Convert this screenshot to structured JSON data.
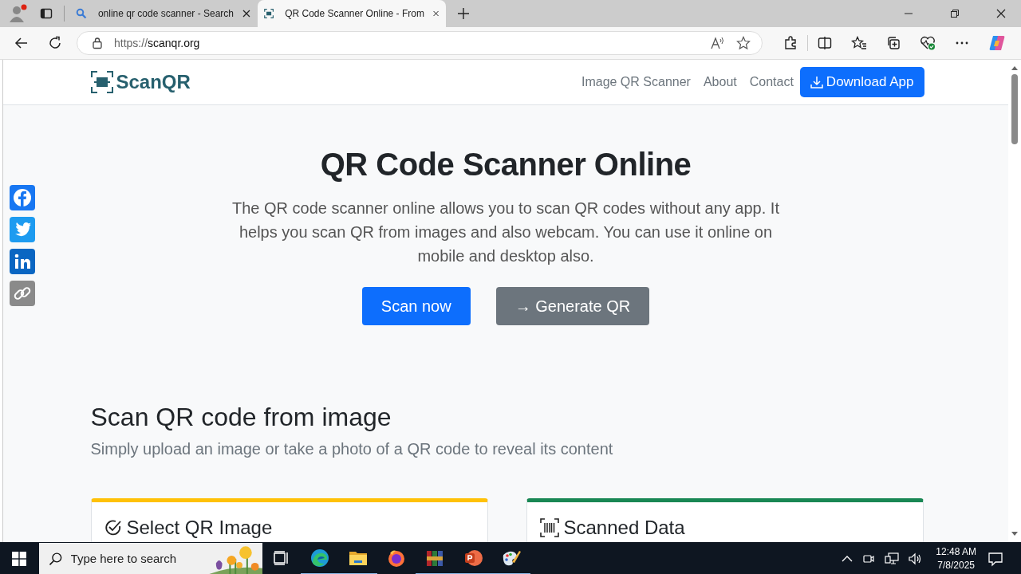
{
  "browser": {
    "tabs": [
      {
        "title": "online qr code scanner - Search",
        "kind": "search",
        "selected": false
      },
      {
        "title": "QR Code Scanner Online - From",
        "kind": "qr",
        "selected": true
      }
    ],
    "url_scheme": "https://",
    "url_host": "scanqr.org"
  },
  "site": {
    "logo": "ScanQR",
    "nav": [
      {
        "label": "Image QR Scanner",
        "kind": "link"
      },
      {
        "label": "About",
        "kind": "link"
      },
      {
        "label": "Contact",
        "kind": "link"
      },
      {
        "label": "Download App",
        "kind": "button"
      }
    ],
    "share": [
      {
        "kind": "facebook"
      },
      {
        "kind": "twitter"
      },
      {
        "kind": "linkedin"
      },
      {
        "kind": "link"
      }
    ],
    "hero": {
      "title": "QR Code Scanner Online",
      "text": "The QR code scanner online allows you to scan QR codes without any app. It helps you scan QR from images and also webcam. You can use it online on mobile and desktop also.",
      "buttons": [
        {
          "label": "Scan now",
          "kind": "primary"
        },
        {
          "label": "→ Generate QR",
          "kind": "secondary"
        }
      ]
    },
    "section": {
      "title": "Scan QR code from image",
      "subtitle": "Simply upload an image or take a photo of a QR code to reveal its content"
    },
    "cards": [
      {
        "title": "Select QR Image",
        "kind": "check",
        "color": "#ffc107"
      },
      {
        "title": "Scanned Data",
        "kind": "barcode",
        "color": "#198754"
      }
    ]
  },
  "taskbar": {
    "search": {
      "placeholder": "Type here to search"
    },
    "apps": [
      {
        "kind": "taskview",
        "running": false
      },
      {
        "kind": "edge",
        "running": true
      },
      {
        "kind": "explorer",
        "running": true
      },
      {
        "kind": "firefox",
        "running": false
      },
      {
        "kind": "winrar",
        "running": true
      },
      {
        "kind": "powerpoint",
        "running": true
      },
      {
        "kind": "paint",
        "running": true
      }
    ],
    "time": "12:48 AM",
    "date": "7/8/2025"
  }
}
